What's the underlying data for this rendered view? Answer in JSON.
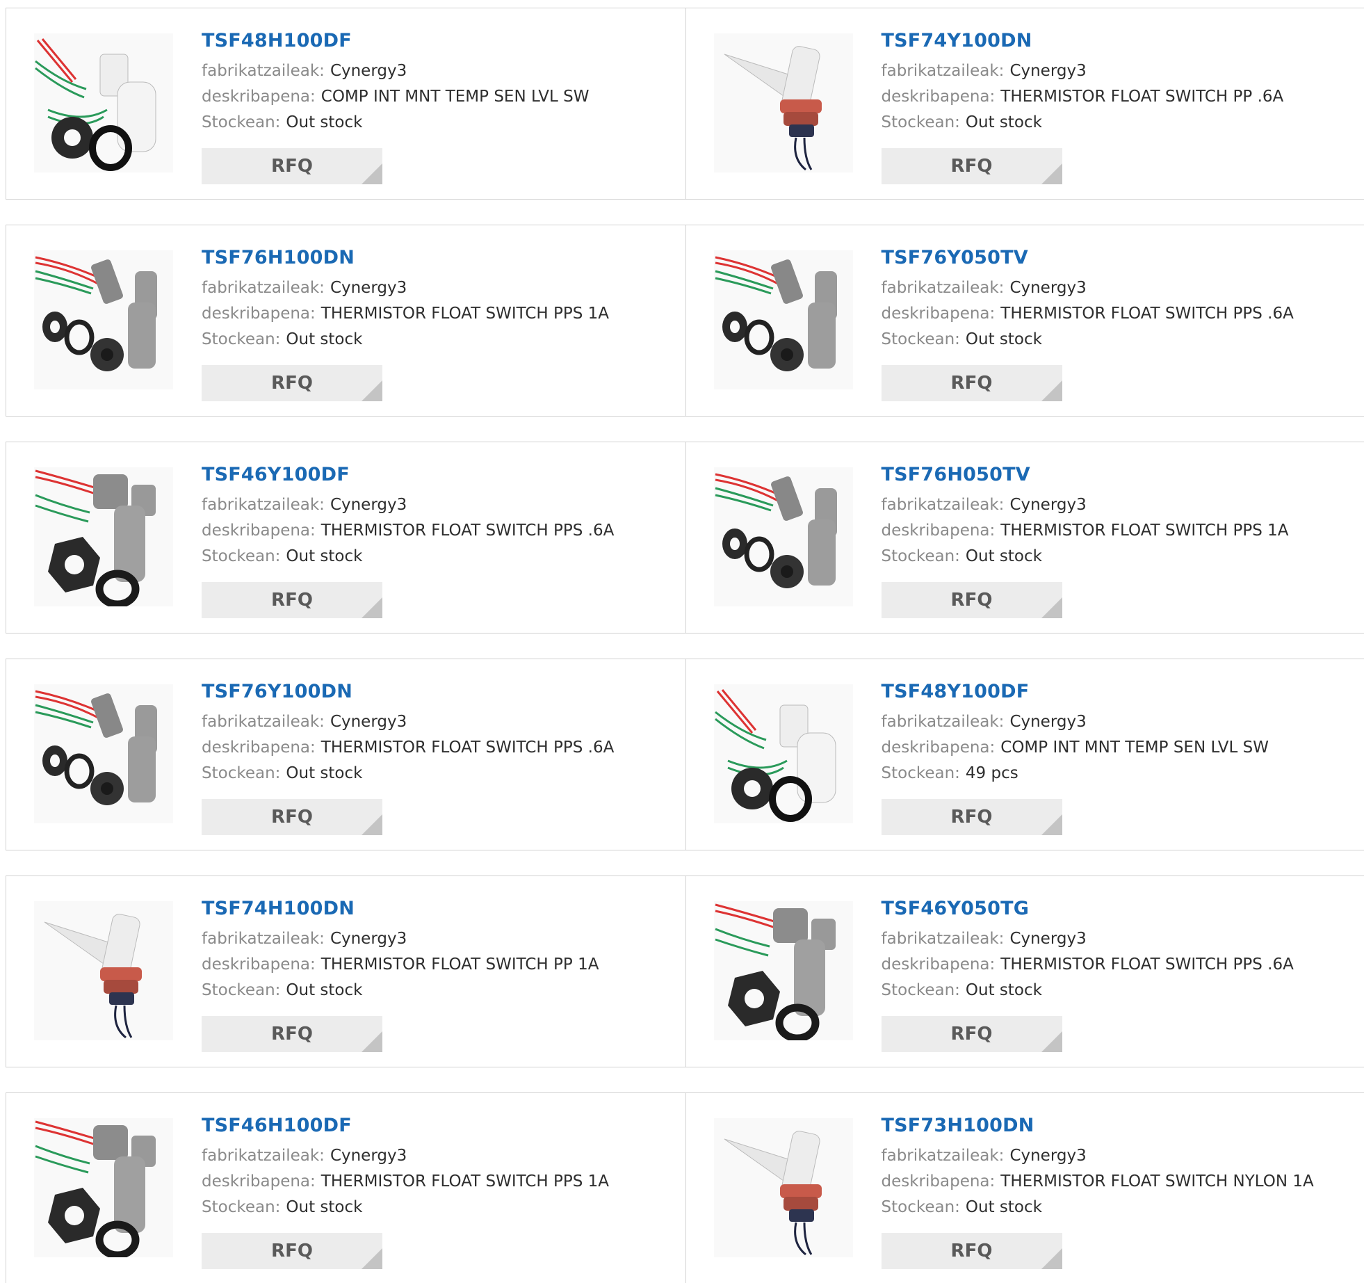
{
  "labels": {
    "manufacturer": "fabrikatzaileak:",
    "description": "deskribapena:",
    "stock": "Stockean:",
    "rfq": "RFQ"
  },
  "colors": {
    "part_number": "#1a69b4",
    "label": "#8a8a8a",
    "value": "#2e2e2e",
    "button_bg": "#ececec"
  },
  "products": [
    {
      "part_number": "TSF48H100DF",
      "manufacturer": "Cynergy3",
      "description": "COMP INT MNT TEMP SEN LVL SW",
      "stock": "Out stock",
      "image_icon": "white-float-switch-icon"
    },
    {
      "part_number": "TSF74Y100DN",
      "manufacturer": "Cynergy3",
      "description": "THERMISTOR FLOAT SWITCH PP .6A",
      "stock": "Out stock",
      "image_icon": "angled-float-sensor-icon"
    },
    {
      "part_number": "TSF76H100DN",
      "manufacturer": "Cynergy3",
      "description": "THERMISTOR FLOAT SWITCH PPS 1A",
      "stock": "Out stock",
      "image_icon": "gray-float-switch-kit-icon"
    },
    {
      "part_number": "TSF76Y050TV",
      "manufacturer": "Cynergy3",
      "description": "THERMISTOR FLOAT SWITCH PPS .6A",
      "stock": "Out stock",
      "image_icon": "gray-float-switch-kit-icon"
    },
    {
      "part_number": "TSF46Y100DF",
      "manufacturer": "Cynergy3",
      "description": "THERMISTOR FLOAT SWITCH PPS .6A",
      "stock": "Out stock",
      "image_icon": "gray-float-switch-nut-icon"
    },
    {
      "part_number": "TSF76H050TV",
      "manufacturer": "Cynergy3",
      "description": "THERMISTOR FLOAT SWITCH PPS 1A",
      "stock": "Out stock",
      "image_icon": "gray-float-switch-kit-icon"
    },
    {
      "part_number": "TSF76Y100DN",
      "manufacturer": "Cynergy3",
      "description": "THERMISTOR FLOAT SWITCH PPS .6A",
      "stock": "Out stock",
      "image_icon": "gray-float-switch-kit-icon"
    },
    {
      "part_number": "TSF48Y100DF",
      "manufacturer": "Cynergy3",
      "description": "COMP INT MNT TEMP SEN LVL SW",
      "stock": "49 pcs",
      "image_icon": "white-float-switch-icon"
    },
    {
      "part_number": "TSF74H100DN",
      "manufacturer": "Cynergy3",
      "description": "THERMISTOR FLOAT SWITCH PP 1A",
      "stock": "Out stock",
      "image_icon": "angled-float-sensor-icon"
    },
    {
      "part_number": "TSF46Y050TG",
      "manufacturer": "Cynergy3",
      "description": "THERMISTOR FLOAT SWITCH PPS .6A",
      "stock": "Out stock",
      "image_icon": "gray-float-switch-nut-icon"
    },
    {
      "part_number": "TSF46H100DF",
      "manufacturer": "Cynergy3",
      "description": "THERMISTOR FLOAT SWITCH PPS 1A",
      "stock": "Out stock",
      "image_icon": "gray-float-switch-nut-icon"
    },
    {
      "part_number": "TSF73H100DN",
      "manufacturer": "Cynergy3",
      "description": "THERMISTOR FLOAT SWITCH NYLON 1A",
      "stock": "Out stock",
      "image_icon": "angled-float-sensor-icon"
    }
  ]
}
